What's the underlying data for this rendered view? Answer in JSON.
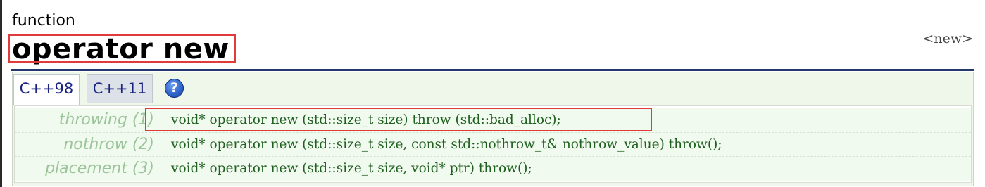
{
  "header": {
    "kind_label": "function",
    "title": "operator new",
    "header_tag": "<new>"
  },
  "tabs": [
    {
      "label": "C++98",
      "active": true
    },
    {
      "label": "C++11",
      "active": false
    }
  ],
  "help_icon": {
    "glyph": "?",
    "icon": "help-icon"
  },
  "declarations": [
    {
      "label": "throwing (1)",
      "code": "void* operator new (std::size_t size) throw (std::bad_alloc);",
      "highlighted": true
    },
    {
      "label": "nothrow (2)",
      "code": "void* operator new (std::size_t size, const std::nothrow_t& nothrow_value) throw();",
      "highlighted": false
    },
    {
      "label": "placement (3)",
      "code": "void* operator new (std::size_t size, void* ptr) throw();",
      "highlighted": false
    }
  ],
  "colors": {
    "highlight": "#e03a3a",
    "title_rule": "#23396b",
    "label_green": "#9cc49a",
    "code_green": "#1f5f1f",
    "tab_text": "#1a237e",
    "panel_bg": "#eef7ea"
  }
}
